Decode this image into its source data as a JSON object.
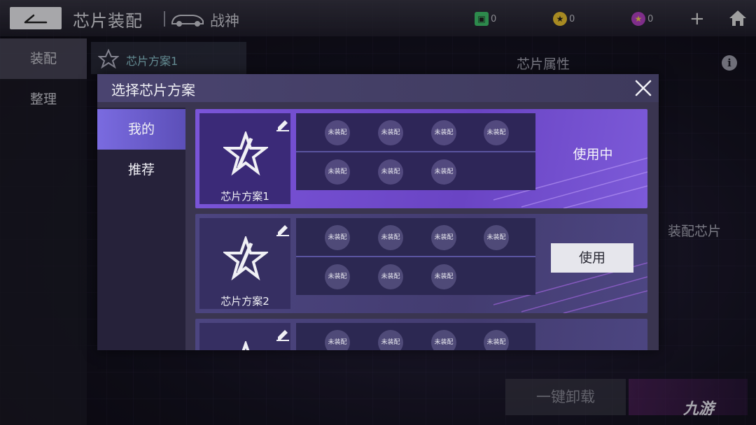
{
  "header": {
    "title": "芯片装配",
    "car_name": "战神",
    "resources": [
      {
        "icon": "green-ticket-icon",
        "value": "0",
        "color": "#3fbf6a"
      },
      {
        "icon": "gold-star-coin-icon",
        "value": "0",
        "color": "#e8c030"
      },
      {
        "icon": "purple-star-coin-icon",
        "value": "0",
        "color": "#b040c0"
      }
    ]
  },
  "nav": {
    "items": [
      {
        "label": "装配",
        "active": true
      },
      {
        "label": "整理",
        "active": false
      }
    ]
  },
  "background": {
    "scheme_tab": "芯片方案1",
    "attr_label": "芯片属性",
    "equip_label": "装配芯片",
    "unload_button": "一键卸载",
    "watermark": "九游"
  },
  "modal": {
    "title": "选择芯片方案",
    "tabs": [
      {
        "label": "我的",
        "active": true
      },
      {
        "label": "推荐",
        "active": false
      }
    ],
    "schemes": [
      {
        "name": "芯片方案1",
        "status": "使用中",
        "active": true,
        "slots": [
          "未装配",
          "未装配",
          "未装配",
          "未装配",
          "未装配",
          "未装配",
          "未装配"
        ]
      },
      {
        "name": "芯片方案2",
        "status": "使用",
        "active": false,
        "slots": [
          "未装配",
          "未装配",
          "未装配",
          "未装配",
          "未装配",
          "未装配",
          "未装配"
        ]
      },
      {
        "name": "",
        "status": "",
        "active": false,
        "slots": [
          "未装配",
          "未装配",
          "未装配",
          "未装配"
        ]
      }
    ]
  }
}
